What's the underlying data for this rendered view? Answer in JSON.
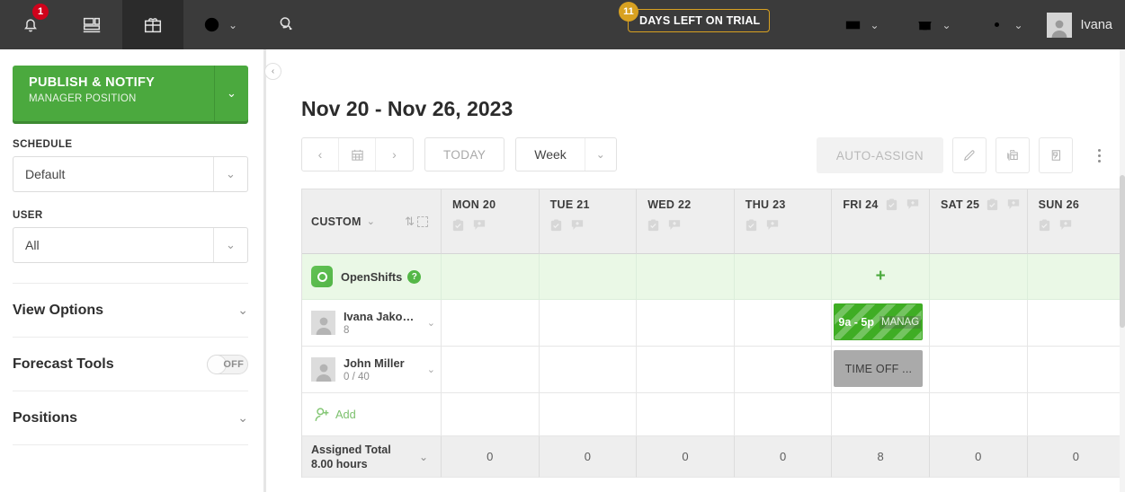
{
  "topnav": {
    "items": [
      {
        "name": "notifications",
        "icon": "bell-icon",
        "badge": "1",
        "active": false
      },
      {
        "name": "dashboard",
        "icon": "dashboard-icon",
        "badge": "",
        "active": false
      },
      {
        "name": "schedule",
        "icon": "calendar-gift-icon",
        "badge": "",
        "active": true
      },
      {
        "name": "timeclock",
        "icon": "clock-icon",
        "badge": "",
        "active": false,
        "chevron": true
      },
      {
        "name": "messages",
        "icon": "chat-bubbles-icon",
        "badge": "",
        "active": false
      }
    ],
    "trial": {
      "days": "11",
      "label": "DAYS LEFT ON TRIAL"
    },
    "right_items": [
      {
        "name": "inbox",
        "icon": "inbox-icon"
      },
      {
        "name": "store",
        "icon": "store-icon"
      },
      {
        "name": "settings",
        "icon": "gear-icon"
      }
    ],
    "user": {
      "name": "Ivana",
      "avatar": "user-avatar"
    }
  },
  "sidebar": {
    "publish": {
      "title": "PUBLISH & NOTIFY",
      "subtitle": "MANAGER POSITION"
    },
    "schedule": {
      "label": "SCHEDULE",
      "value": "Default"
    },
    "user": {
      "label": "USER",
      "value": "All"
    },
    "panels": [
      {
        "title": "View Options",
        "type": "collapse"
      },
      {
        "title": "Forecast Tools",
        "type": "toggle",
        "toggle_state": "OFF"
      },
      {
        "title": "Positions",
        "type": "collapse"
      }
    ],
    "collapse_icon": "chevron-left-icon"
  },
  "main": {
    "page_title": "Nov 20 - Nov 26, 2023",
    "nav": {
      "prev": "‹",
      "calendar_icon": "calendar-icon",
      "next": "›",
      "today": "TODAY",
      "range_value": "Week"
    },
    "tools": {
      "auto_assign": "AUTO-ASSIGN",
      "buttons": [
        {
          "name": "edit-button",
          "icon": "pencil-icon"
        },
        {
          "name": "copy-shifts-button",
          "icon": "copy-calendar-icon"
        },
        {
          "name": "templates-button",
          "icon": "template-icon"
        },
        {
          "name": "more-button",
          "icon": "more-vertical-icon"
        }
      ]
    }
  },
  "grid": {
    "name_header": {
      "label": "CUSTOM",
      "sort_icon": "sort-arrows-icon",
      "select_icon": "dashed-square-icon"
    },
    "days": [
      {
        "label": "MON 20",
        "icons_inline": false
      },
      {
        "label": "TUE 21",
        "icons_inline": false
      },
      {
        "label": "WED 22",
        "icons_inline": false
      },
      {
        "label": "THU 23",
        "icons_inline": false
      },
      {
        "label": "FRI 24",
        "icons_inline": true
      },
      {
        "label": "SAT 25",
        "icons_inline": true
      },
      {
        "label": "SUN 26",
        "icons_inline": false
      }
    ],
    "day_icons": [
      "clipboard-check-icon",
      "note-add-icon"
    ],
    "open_shifts": {
      "label": "OpenShifts",
      "help_badge": "?",
      "icon": "open-shifts-icon",
      "cells": [
        "",
        "",
        "",
        "",
        "+",
        "",
        ""
      ]
    },
    "employees": [
      {
        "name": "Ivana Jako…",
        "hours": "8",
        "avatar": "user-avatar",
        "cells": [
          {
            "type": "empty"
          },
          {
            "type": "empty"
          },
          {
            "type": "empty"
          },
          {
            "type": "empty"
          },
          {
            "type": "shift",
            "time": "9a - 5p",
            "position": "MANAG"
          },
          {
            "type": "empty"
          },
          {
            "type": "empty"
          }
        ]
      },
      {
        "name": "John Miller",
        "hours": "0 / 40",
        "avatar": "user-avatar",
        "cells": [
          {
            "type": "empty"
          },
          {
            "type": "empty"
          },
          {
            "type": "empty"
          },
          {
            "type": "empty"
          },
          {
            "type": "timeoff",
            "label": "TIME OFF ..."
          },
          {
            "type": "empty"
          },
          {
            "type": "empty"
          }
        ]
      }
    ],
    "add_row": {
      "label": "Add",
      "icon": "add-user-icon"
    },
    "totals": {
      "line1": "Assigned Total",
      "line2": "8.00 hours",
      "values": [
        "0",
        "0",
        "0",
        "0",
        "8",
        "0",
        "0"
      ]
    }
  },
  "colors": {
    "nav_bg": "#3b3b3b",
    "nav_active": "#2b2b2b",
    "publish_green": "#4ba93e",
    "open_row_green": "#eaf8e6",
    "shift_green": "#3fad24",
    "timeoff_grey": "#aaaaaa",
    "trial_gold": "#d8a121",
    "badge_red": "#d0021b"
  }
}
